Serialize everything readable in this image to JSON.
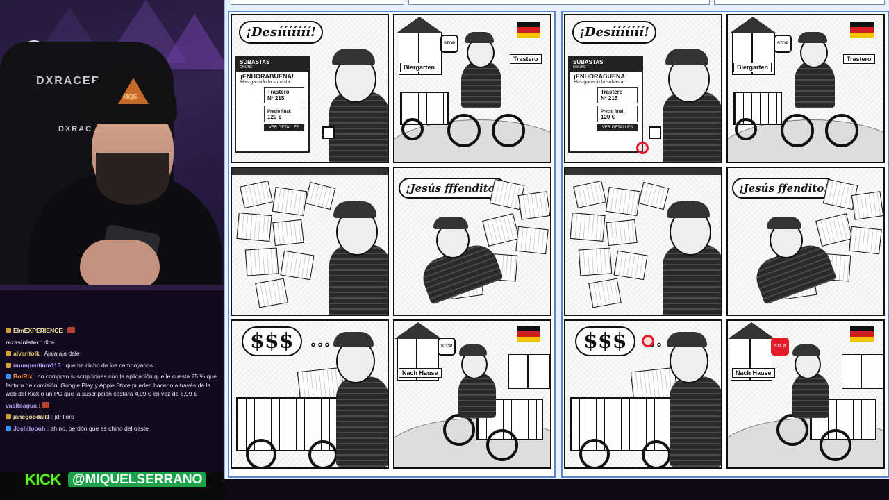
{
  "stream": {
    "chair_brand": "DXRACER",
    "chair_brand_small": "DXRAC",
    "cap_logo_text": "MQS"
  },
  "chat": {
    "messages": [
      {
        "user": "ElmEXPERIENCE",
        "text": "",
        "user_color": "#f5e9a0",
        "badge_color": "#d4a03a",
        "emote": true
      },
      {
        "user": "rezasinister",
        "text": "dice",
        "user_color": "#c9c9d6",
        "badge_color": "",
        "emote": false
      },
      {
        "user": "alvaritolk",
        "text": "Ajajajaja dale",
        "user_color": "#e8cf7a",
        "badge_color": "#d4a03a",
        "emote": false
      },
      {
        "user": "ununpentium115",
        "text": "que ha dicho de los camboyanos",
        "user_color": "#b9a3ff",
        "badge_color": "#d4a03a",
        "emote": false
      },
      {
        "user": "BotRix",
        "text": "no compren suscripciones con la aplicación que le cuesta 25 % que factura de comisión, Google Play y Apple Store pueden hacerlo a través de la web del Kick o un PC que la suscripción costará 4,99 € en vez de 6,99 €",
        "user_color": "#ff9a4a",
        "badge_color": "#3a8cff",
        "emote": false
      },
      {
        "user": "vasitoagua",
        "text": "",
        "user_color": "#b9a3ff",
        "badge_color": "",
        "emote": true
      },
      {
        "user": "janegoodall1",
        "text": "jdr lloro",
        "user_color": "#f5e9a0",
        "badge_color": "#d4a03a",
        "emote": false
      },
      {
        "user": "Joshitoooh",
        "text": "ah no, perdón que es chino del oeste",
        "user_color": "#b9a3ff",
        "badge_color": "#3a8cff",
        "emote": false
      }
    ]
  },
  "brand": {
    "platform": "KICK",
    "handle": "@MIQUELSERRANO",
    "color": "#53fc18"
  },
  "comic": {
    "speech_1": "¡Desííííííí!",
    "auction_brand": "SUBASTAS",
    "auction_brand_sub": "ONLINE",
    "congrats": "¡ENHORABUENA!",
    "won_text": "Has ganado la subasta",
    "lot_name": "Trastero",
    "lot_number": "Nº 215",
    "price_label": "Precio final:",
    "price_value": "120 €",
    "details_button": "VER DETALLES",
    "stop_text": "STOP",
    "sign_left": "Biergarten",
    "sign_right": "Trastero",
    "speech_2_left": "¡Jesús fffendito!",
    "speech_2_right": "¡Jesús ffendito!",
    "money_thought": "$$$",
    "sign_home": "Nach Hause"
  },
  "differences_found": 3,
  "colors": {
    "accent_difference": "#e51a2a",
    "board_border": "#5b86c9",
    "flag": [
      "#111111",
      "#d22020",
      "#f3c400"
    ]
  }
}
